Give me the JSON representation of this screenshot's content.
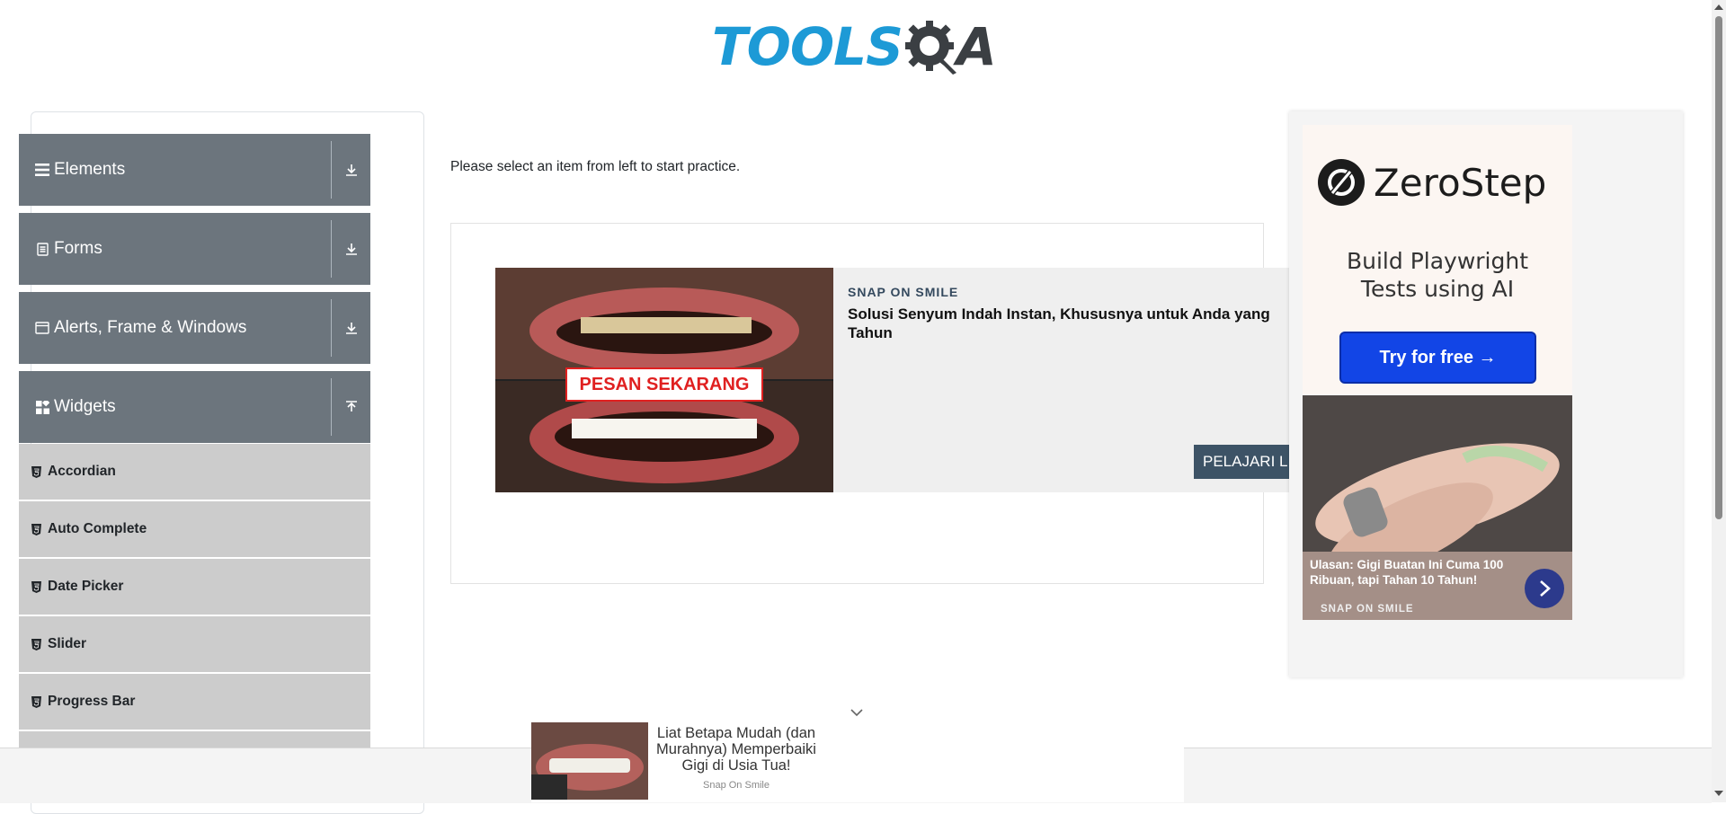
{
  "header": {
    "logo_left": "TOOLS",
    "logo_right": "A",
    "logo_alt": "ToolsQA"
  },
  "sidebar": {
    "groups": [
      {
        "label": "Elements",
        "icon": "hamburger-icon",
        "expanded": false
      },
      {
        "label": "Forms",
        "icon": "document-icon",
        "expanded": false
      },
      {
        "label": "Alerts, Frame & Windows",
        "icon": "window-icon",
        "expanded": false
      },
      {
        "label": "Widgets",
        "icon": "widgets-grid-icon",
        "expanded": true
      }
    ],
    "widget_items": [
      {
        "label": "Accordian"
      },
      {
        "label": "Auto Complete"
      },
      {
        "label": "Date Picker"
      },
      {
        "label": "Slider"
      },
      {
        "label": "Progress Bar"
      }
    ]
  },
  "main": {
    "intro": "Please select an item from left to start practice."
  },
  "ad_center": {
    "sponsor": "SNAP ON SMILE",
    "headline": "Solusi Senyum Indah Instan, Khususnya untuk Anda yang Tahun",
    "image_overlay": "PESAN SEKARANG",
    "cta": "PELAJARI L"
  },
  "ad_right": {
    "brand": "ZeroStep",
    "tagline_1": "Build Playwright",
    "tagline_2": "Tests using AI",
    "button": "Try for free →",
    "snap_title": "Ulasan: Gigi Buatan Ini Cuma 100 Ribuan, tapi Tahan 10 Tahun!",
    "snap_sponsor": "SNAP ON SMILE"
  },
  "ad_bottom": {
    "text": "Liat Betapa Mudah (dan Murahnya) Memperbaiki Gigi di Usia Tua!",
    "sponsor": "Snap On Smile"
  },
  "colors": {
    "header_bg": "#6c757d",
    "subitem_bg": "#cccccc",
    "brand_blue": "#1d9ad6",
    "zerostep_btn": "#1245e6"
  }
}
